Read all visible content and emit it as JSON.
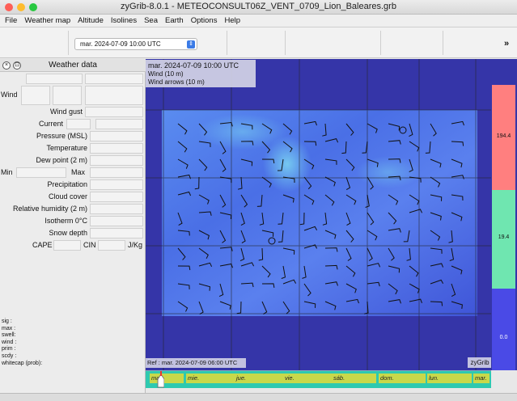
{
  "window": {
    "title": "zyGrib-8.0.1 - METEOCONSULT06Z_VENT_0709_Lion_Baleares.grb"
  },
  "menu": [
    "File",
    "Weather map",
    "Altitude",
    "Isolines",
    "Sea",
    "Earth",
    "Options",
    "Help"
  ],
  "toolbar": {
    "date_value": "mar. 2024-07-09 10:00 UTC",
    "more_glyph": "»"
  },
  "weather_panel": {
    "title": "Weather data",
    "wind_label": "Wind",
    "rows": [
      "Wind gust",
      "Current",
      "Pressure (MSL)",
      "Temperature",
      "Dew point (2 m)"
    ],
    "min_label": "Min",
    "max_label": "Max",
    "rows2": [
      "Precipitation",
      "Cloud cover",
      "Relative humidity (2 m)",
      "Isotherm 0°C",
      "Snow depth"
    ],
    "cape_label": "CAPE",
    "cin_label": "CIN",
    "jkg_label": "J/Kg"
  },
  "wave_info": [
    "sig  :",
    "max  :",
    "swell:",
    "wind :",
    "prim :",
    "scdy :",
    "whitecap (prob):"
  ],
  "map": {
    "date": "mar. 2024-07-09 10:00 UTC",
    "layer1": "Wind (10 m)",
    "layer2": "Wind arrows (10 m)",
    "ref": "Ref : mar. 2024-07-09 06:00 UTC",
    "brand": "zyGrib"
  },
  "legend": {
    "values": [
      "194.4",
      "19.4",
      "0.0"
    ],
    "colors": [
      "#ff7f7f",
      "#6fe6b0",
      "#4a4ae6"
    ]
  },
  "timeline": {
    "days": [
      "mar.",
      "mie.",
      "jue.",
      "vie.",
      "sáb.",
      "dom.",
      "lun.",
      "mar."
    ]
  },
  "colors": {
    "sea": "#3535a8",
    "field": "#4a63e0",
    "timeline": "#2ec9b0",
    "day_band": "#c8d84a"
  }
}
